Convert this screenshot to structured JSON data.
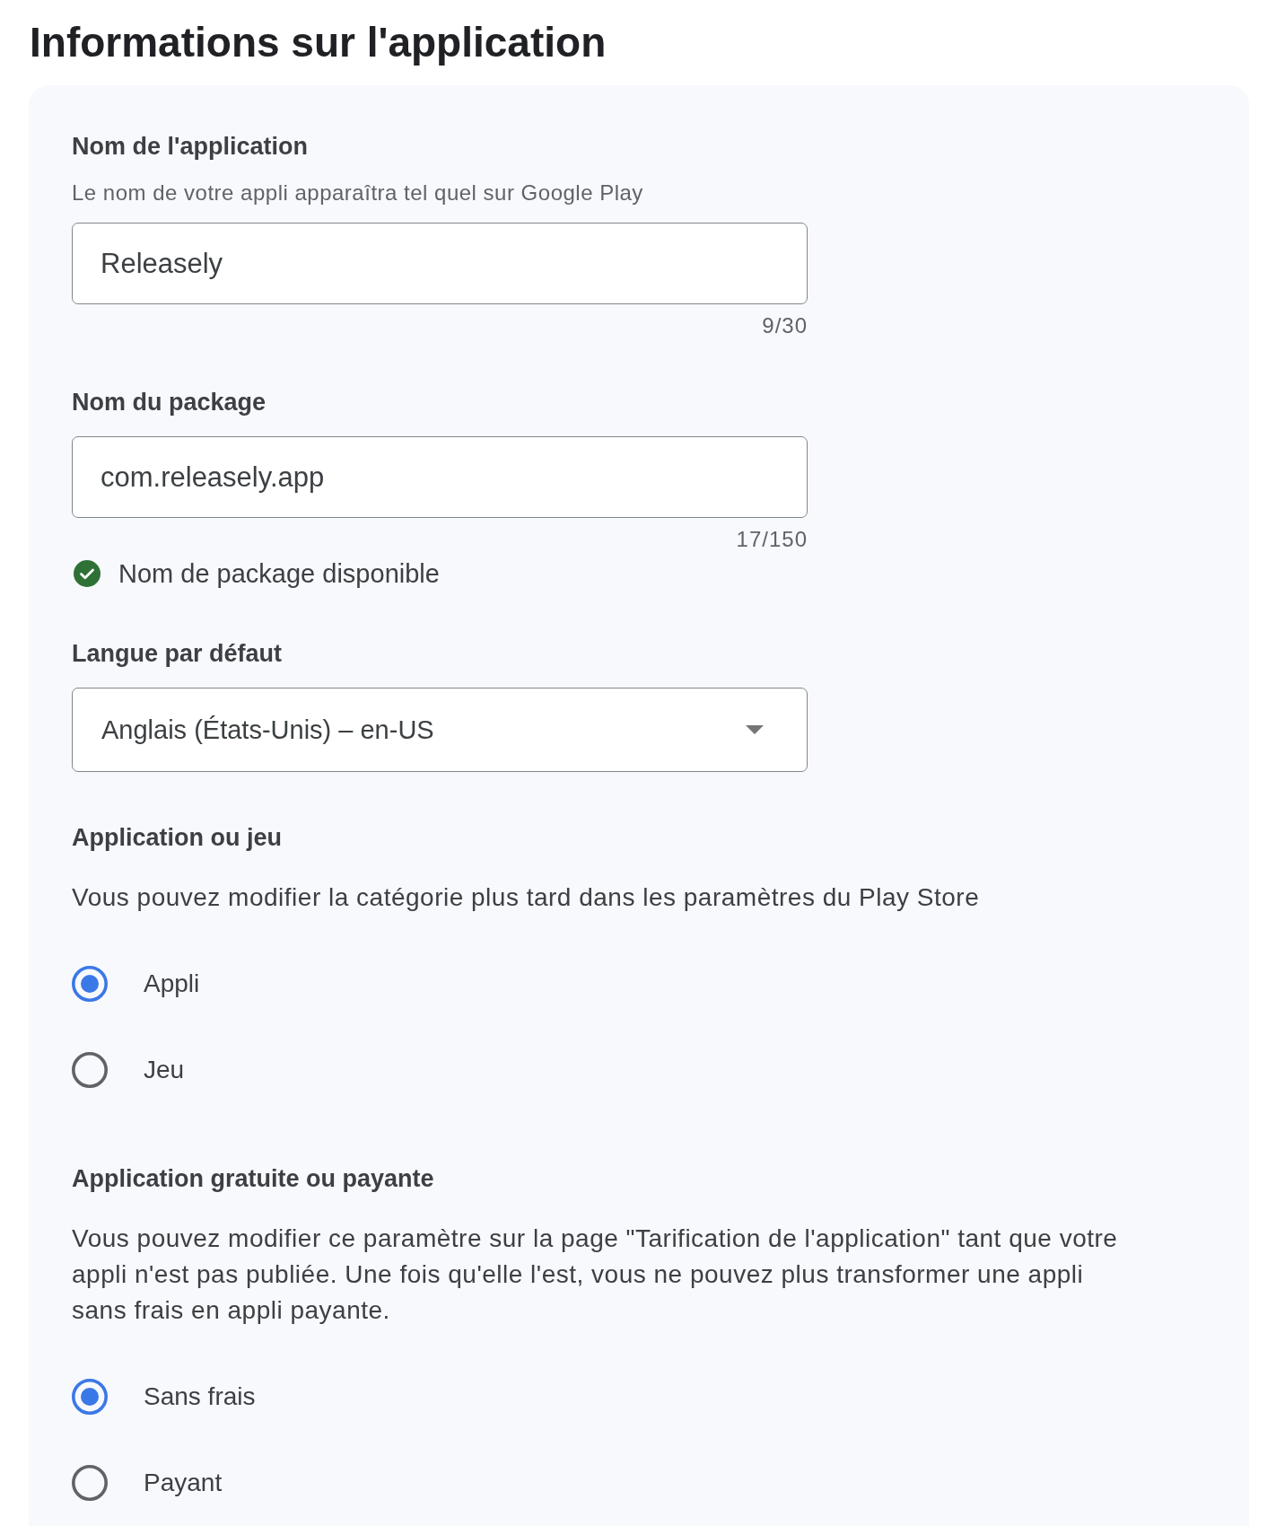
{
  "title": "Informations sur l'application",
  "fields": [
    {
      "kind": "text",
      "label": "Nom de l'application",
      "hint": "Le nom de votre appli apparaîtra tel quel sur Google Play",
      "value": "Releasely",
      "counter": "9/30"
    },
    {
      "kind": "text",
      "label": "Nom du package",
      "value": "com.releasely.app",
      "counter": "17/150",
      "status": {
        "kind": "success",
        "text": "Nom de package disponible"
      }
    },
    {
      "kind": "select",
      "label": "Langue par défaut",
      "value": "Anglais (États-Unis) – en-US"
    },
    {
      "kind": "radio",
      "label": "Application ou jeu",
      "description": "Vous pouvez modifier la catégorie plus tard dans les paramètres du Play Store",
      "options": [
        {
          "label": "Appli",
          "selected": true
        },
        {
          "label": "Jeu",
          "selected": false
        }
      ]
    },
    {
      "kind": "radio",
      "label": "Application gratuite ou payante",
      "description": "Vous pouvez modifier ce paramètre sur la page \"Tarification de l'application\" tant que votre appli n'est pas publiée. Une fois qu'elle l'est, vous ne pouvez plus transformer une appli sans frais en appli payante.",
      "options": [
        {
          "label": "Sans frais",
          "selected": true
        },
        {
          "label": "Payant",
          "selected": false
        }
      ]
    }
  ]
}
